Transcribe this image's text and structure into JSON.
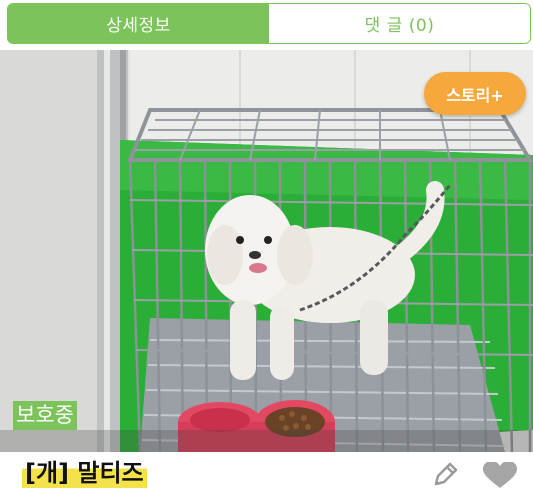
{
  "tabs": [
    {
      "label": "상세정보",
      "active": true
    },
    {
      "label": "댓 글 (0)",
      "active": false
    }
  ],
  "photo": {
    "icon": "dog-in-cage-photo",
    "story_button": "스토리+",
    "status": "보호중"
  },
  "animal": {
    "title": "[개] 말티즈"
  },
  "actions": {
    "edit_icon": "pencil-icon",
    "favorite_icon": "heart-icon"
  },
  "colors": {
    "accent": "#7cc35c",
    "story": "#f6a83c",
    "highlight": "#f4e24a"
  }
}
